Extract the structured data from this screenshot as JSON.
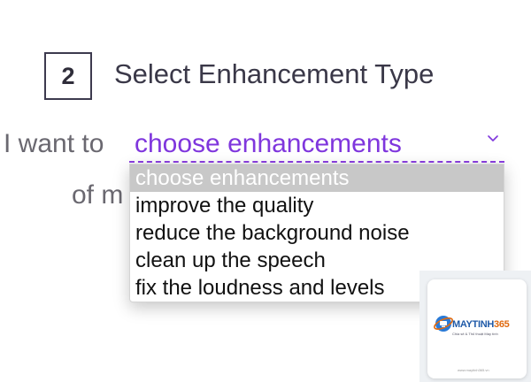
{
  "step": {
    "number": "2",
    "title": "Select Enhancement Type"
  },
  "sentence": {
    "prefix": "I want to",
    "line2_visible": "of m"
  },
  "select": {
    "value": "choose enhancements",
    "chevron_icon": "chevron-down-icon",
    "accent_color": "#7f36dd",
    "options": [
      {
        "label": "choose enhancements",
        "selected": true
      },
      {
        "label": "improve the quality",
        "selected": false
      },
      {
        "label": "reduce the background noise",
        "selected": false
      },
      {
        "label": "clean up the speech",
        "selected": false
      },
      {
        "label": "fix the loudness and levels",
        "selected": false
      }
    ]
  },
  "watermark": {
    "brand": "MAYTINH",
    "brand_number": "365",
    "tagline": "Chia sẻ & Thủ thuật Máy tính",
    "footer": "www.maytinh365.vn"
  }
}
